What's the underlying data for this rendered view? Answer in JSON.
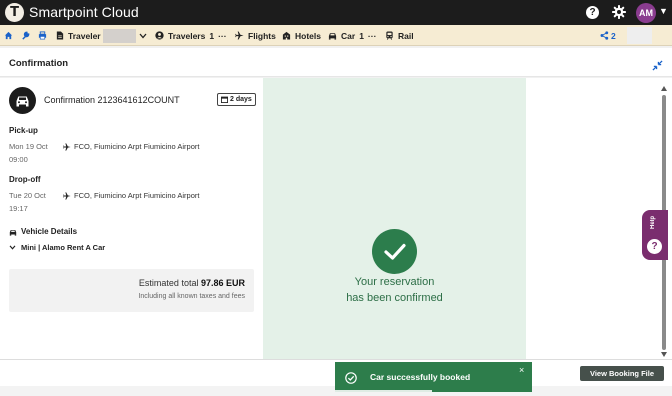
{
  "app": {
    "title": "Smartpoint Cloud",
    "logo_letter": "T",
    "avatar_initials": "AM"
  },
  "toolbar": {
    "traveler_label": "Traveler",
    "travelers_label": "Travelers",
    "travelers_count": "1",
    "flights_label": "Flights",
    "hotels_label": "Hotels",
    "car_label": "Car",
    "car_count": "1",
    "rail_label": "Rail",
    "share_count": "2",
    "more": "···"
  },
  "header": {
    "title": "Confirmation"
  },
  "booking": {
    "confirmation": "Confirmation 2123641612COUNT",
    "duration": "2 days",
    "pickup_label": "Pick-up",
    "pickup_date": "Mon 19 Oct",
    "pickup_time": "09:00",
    "pickup_location": "FCO, Fiumicino Arpt Fiumicino Airport",
    "dropoff_label": "Drop-off",
    "dropoff_date": "Tue 20 Oct",
    "dropoff_time": "19:17",
    "dropoff_location": "FCO, Fiumicino Arpt Fiumicino Airport",
    "vehicle_label": "Vehicle Details",
    "vehicle": "Mini | Alamo Rent A Car",
    "total_label": "Estimated total",
    "total_value": "97.86 EUR",
    "taxes_note": "Including all known taxes and fees"
  },
  "confirmation_panel": {
    "line1": "Your reservation",
    "line2": "has been confirmed"
  },
  "help": {
    "label": "Help",
    "icon": "?"
  },
  "footer": {
    "view_booking": "View Booking File"
  },
  "toast": {
    "message": "Car successfully booked",
    "close": "×",
    "progress": 0.49
  },
  "colors": {
    "brand_dark": "#1c1c1c",
    "toolbar": "#f6ecd3",
    "success": "#2d7d4b",
    "success_bg": "#e4f1e8",
    "help": "#7a2d6e",
    "avatar": "#8a3c8f"
  }
}
